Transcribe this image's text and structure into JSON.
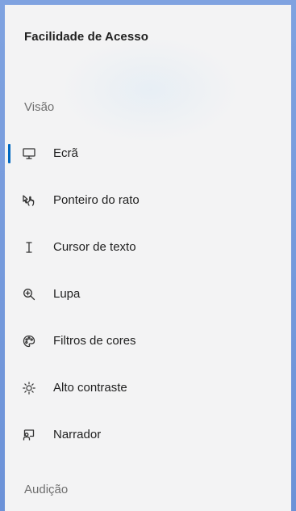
{
  "panel": {
    "title": "Facilidade de Acesso"
  },
  "sections": {
    "vision": "Visão",
    "hearing": "Audição"
  },
  "nav_items": [
    {
      "label": "Ecrã",
      "icon": "monitor-icon",
      "selected": true
    },
    {
      "label": "Ponteiro do rato",
      "icon": "mouse-pointer-icon",
      "selected": false
    },
    {
      "label": "Cursor de texto",
      "icon": "text-cursor-icon",
      "selected": false
    },
    {
      "label": "Lupa",
      "icon": "magnifier-icon",
      "selected": false
    },
    {
      "label": "Filtros de cores",
      "icon": "color-palette-icon",
      "selected": false
    },
    {
      "label": "Alto contraste",
      "icon": "high-contrast-sun-icon",
      "selected": false
    },
    {
      "label": "Narrador",
      "icon": "narrator-icon",
      "selected": false
    }
  ],
  "colors": {
    "accent": "#0067c0",
    "background": "#f3f3f4",
    "frame": "#6c92d8"
  }
}
